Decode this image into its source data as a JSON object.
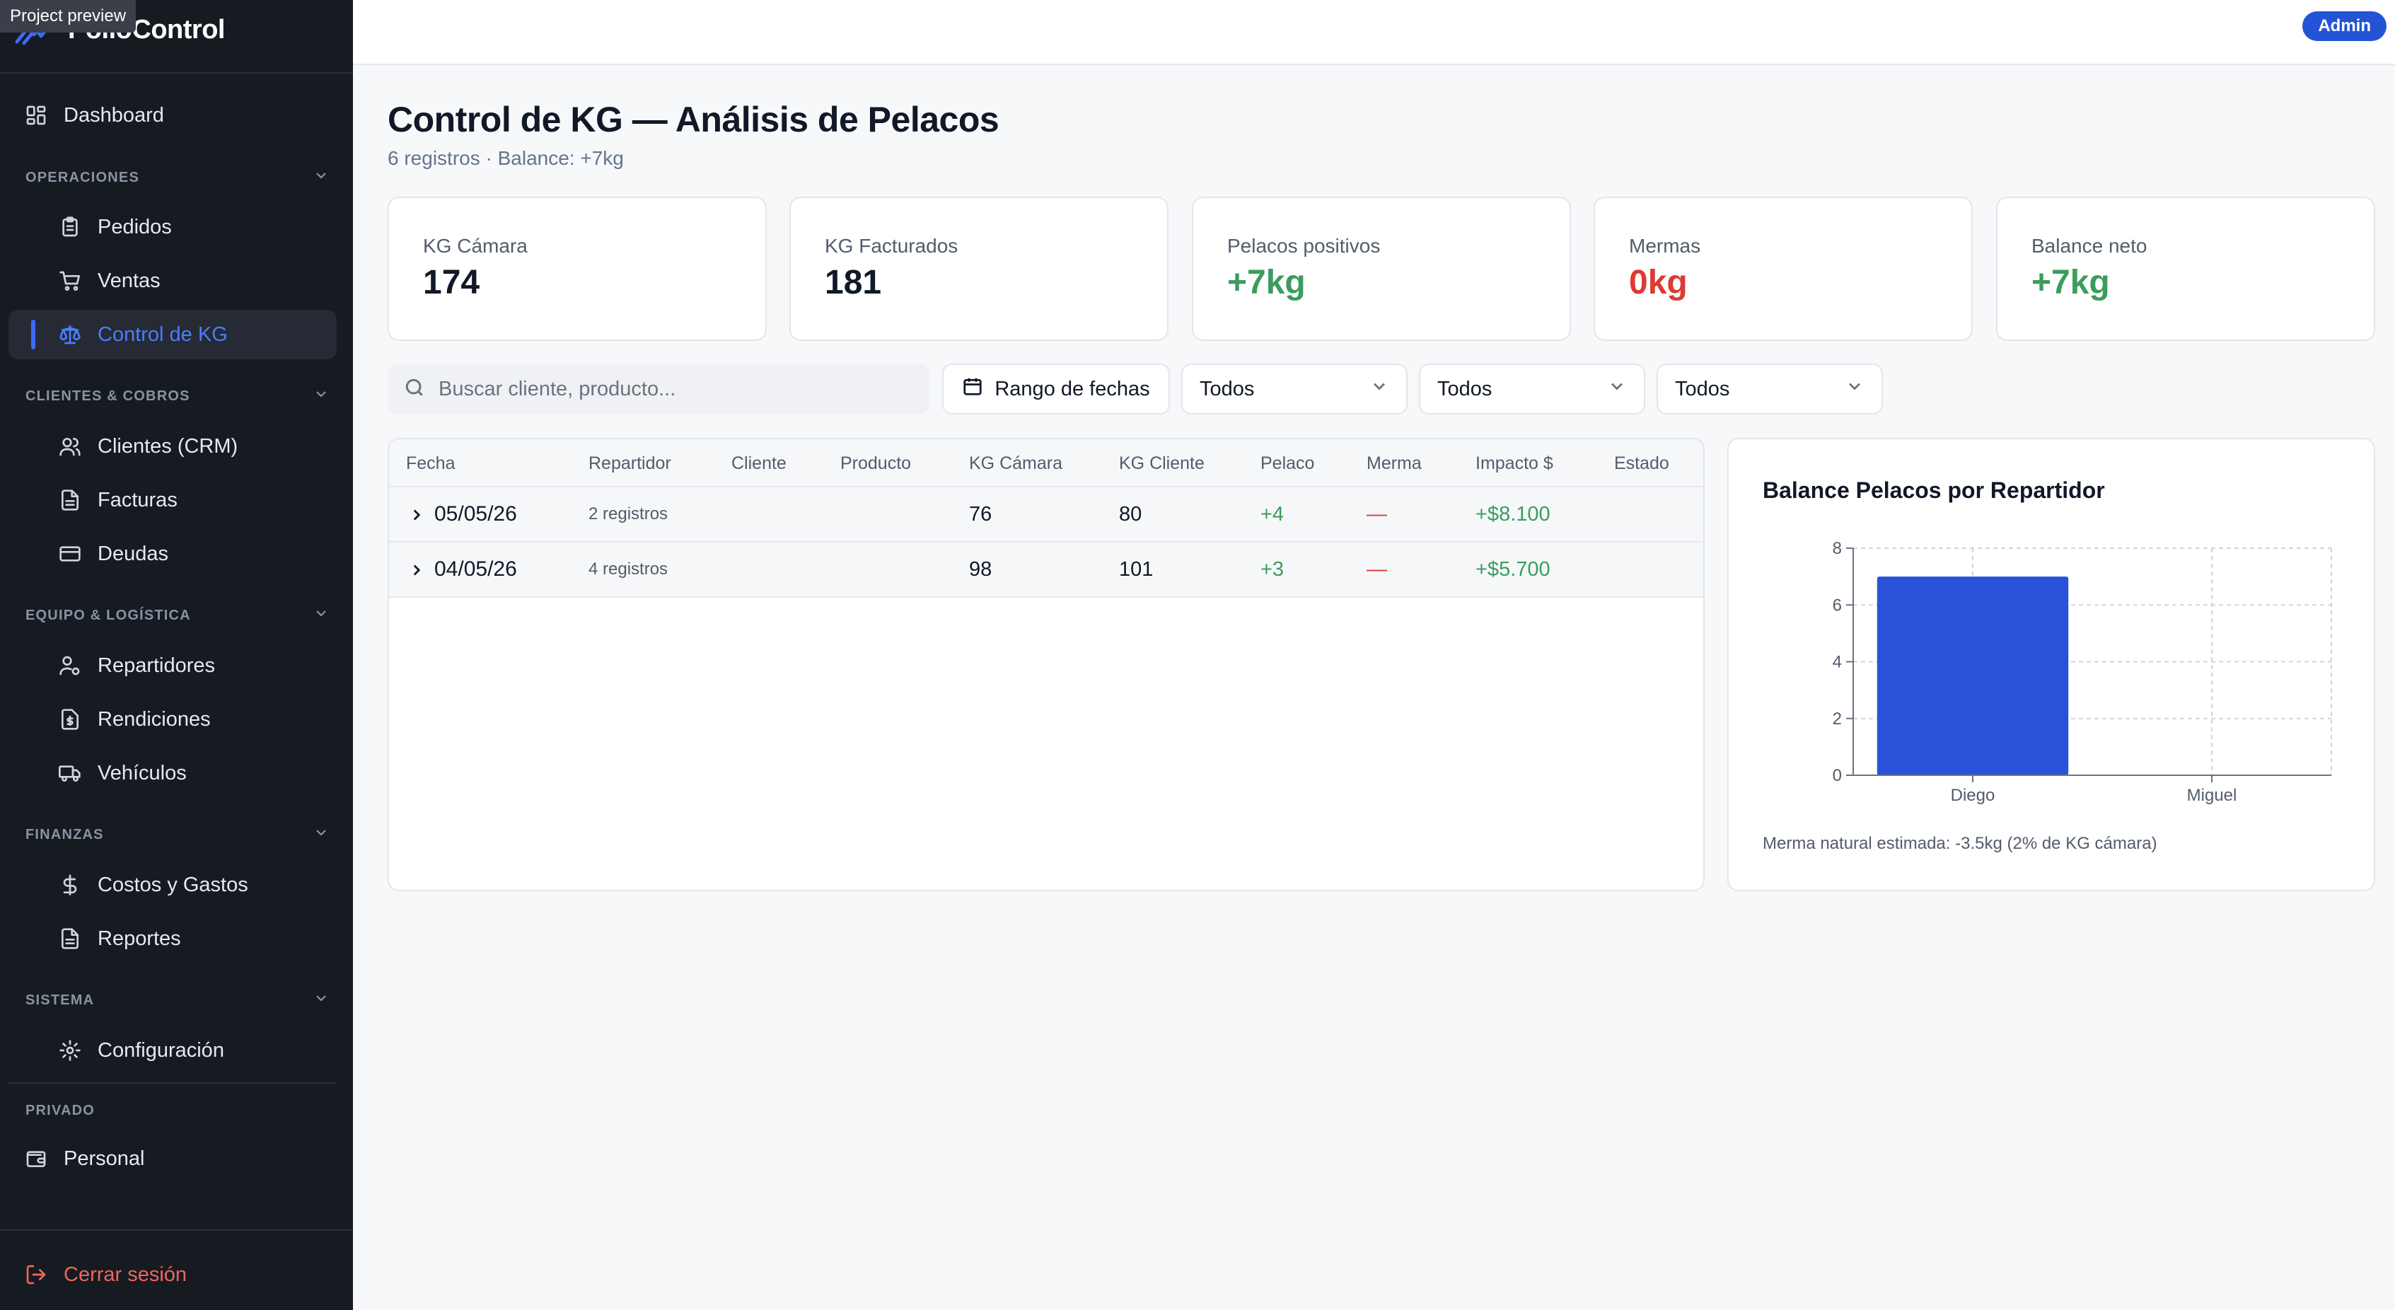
{
  "app": {
    "preview_tag": "Project preview",
    "brand": "PolloControl",
    "user_badge": "Admin"
  },
  "sidebar": {
    "dashboard": "Dashboard",
    "sections": [
      {
        "title": "OPERACIONES",
        "items": [
          "Pedidos",
          "Ventas",
          "Control de KG"
        ]
      },
      {
        "title": "CLIENTES & COBROS",
        "items": [
          "Clientes (CRM)",
          "Facturas",
          "Deudas"
        ]
      },
      {
        "title": "EQUIPO & LOGÍSTICA",
        "items": [
          "Repartidores",
          "Rendiciones",
          "Vehículos"
        ]
      },
      {
        "title": "FINANZAS",
        "items": [
          "Costos y Gastos",
          "Reportes"
        ]
      },
      {
        "title": "SISTEMA",
        "items": [
          "Configuración"
        ]
      }
    ],
    "private_title": "PRIVADO",
    "private_item": "Personal",
    "logout": "Cerrar sesión",
    "active_item": "Control de KG"
  },
  "page": {
    "title": "Control de KG — Análisis de Pelacos",
    "subtitle": "6 registros · Balance: +7kg"
  },
  "kpis": [
    {
      "label": "KG Cámara",
      "value": "174"
    },
    {
      "label": "KG Facturados",
      "value": "181"
    },
    {
      "label": "Pelacos positivos",
      "value": "+7kg"
    },
    {
      "label": "Mermas",
      "value": "0kg"
    },
    {
      "label": "Balance neto",
      "value": "+7kg"
    }
  ],
  "filters": {
    "search_placeholder": "Buscar cliente, producto...",
    "date_range": "Rango de fechas",
    "selects": [
      "Todos",
      "Todos",
      "Todos"
    ]
  },
  "table": {
    "columns": [
      "Fecha",
      "Repartidor",
      "Cliente",
      "Producto",
      "KG Cámara",
      "KG Cliente",
      "Pelaco",
      "Merma",
      "Impacto $",
      "Estado"
    ],
    "rows": [
      {
        "fecha": "05/05/26",
        "repartidor": "2 registros",
        "cliente": "",
        "producto": "",
        "kg_camara": "76",
        "kg_cliente": "80",
        "pelaco": "+4",
        "merma": "—",
        "impacto": "+$8.100",
        "estado": ""
      },
      {
        "fecha": "04/05/26",
        "repartidor": "4 registros",
        "cliente": "",
        "producto": "",
        "kg_camara": "98",
        "kg_cliente": "101",
        "pelaco": "+3",
        "merma": "—",
        "impacto": "+$5.700",
        "estado": ""
      }
    ]
  },
  "chart_data": {
    "type": "bar",
    "title": "Balance Pelacos por Repartidor",
    "categories": [
      "Diego",
      "Miguel"
    ],
    "values": [
      7,
      0
    ],
    "ylim": [
      0,
      8
    ],
    "yticks": [
      0,
      2,
      4,
      6,
      8
    ],
    "grid": true,
    "bar_color": "#2952d9",
    "note": "Merma natural estimada: -3.5kg (2% de KG cámara)"
  },
  "colors": {
    "accent": "#2454d6",
    "positive": "#3a9d5d",
    "negative": "#dc3a32",
    "sidebar_bg": "#161a21"
  }
}
